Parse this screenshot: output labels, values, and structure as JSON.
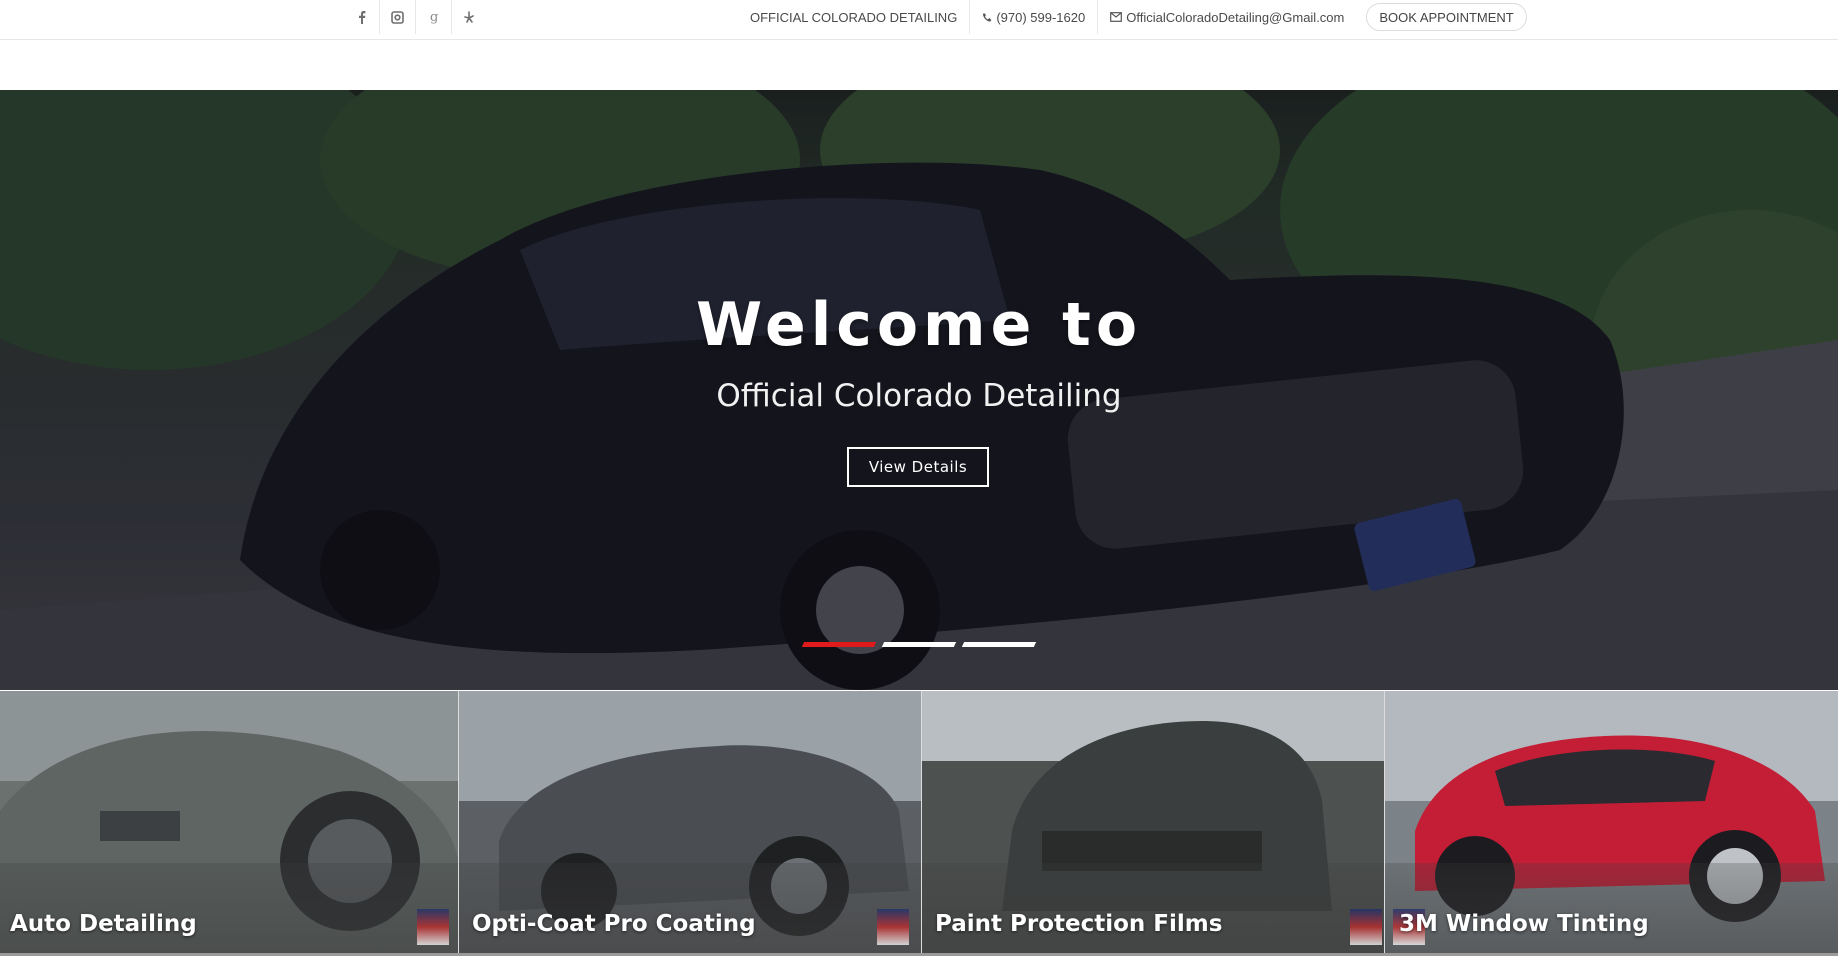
{
  "topbar": {
    "social": [
      {
        "icon": "facebook-icon",
        "glyph": "f"
      },
      {
        "icon": "instagram-icon",
        "glyph": "◙"
      },
      {
        "icon": "google-plus-icon",
        "glyph": "g"
      },
      {
        "icon": "yelp-icon",
        "glyph": "✲"
      }
    ],
    "business_name": "OFFICIAL COLORADO DETAILING",
    "phone": "(970) 599-1620",
    "email": "OfficialColoradoDetailing@Gmail.com",
    "book_label": "BOOK APPOINTMENT"
  },
  "hero": {
    "title": "Welcome to",
    "subtitle": "Official Colorado Detailing",
    "button_label": "View Details",
    "slides": 3,
    "active_slide": 1,
    "accent_color": "#e11b1b"
  },
  "services": [
    {
      "label": "Auto Detailing",
      "color": "#6b716f"
    },
    {
      "label": "Opti-Coat Pro Coating",
      "color": "#5c6064"
    },
    {
      "label": "Paint Protection Films",
      "color": "#4d5150"
    },
    {
      "label": "3M Window Tinting",
      "color": "#c41e36"
    }
  ]
}
